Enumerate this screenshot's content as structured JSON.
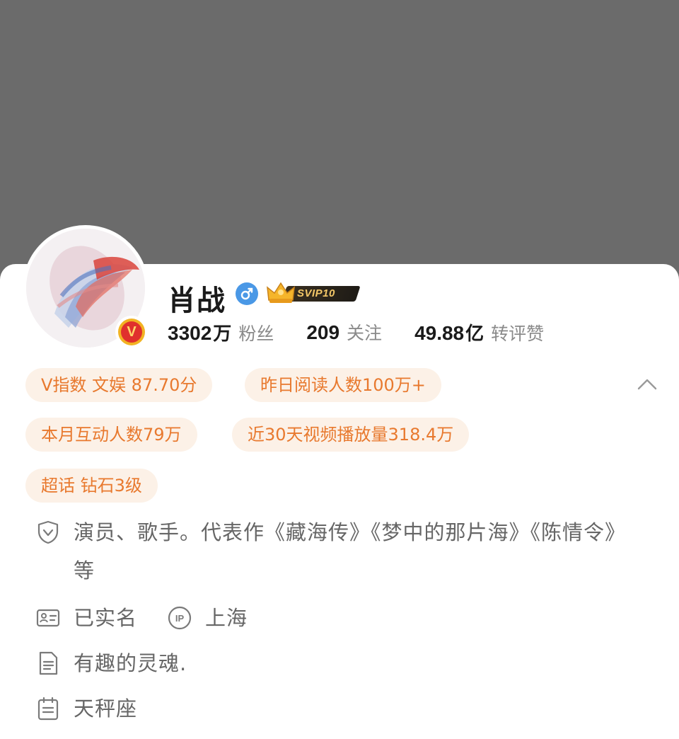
{
  "profile": {
    "name": "肖战",
    "svip_label": "SVIP10",
    "stats": {
      "fans_num": "3302",
      "fans_unit": "万",
      "fans_label": "粉丝",
      "following_num": "209",
      "following_label": "关注",
      "likes_num": "49.88",
      "likes_unit": "亿",
      "likes_label": "转评赞"
    }
  },
  "tags": [
    "V指数 文娱 87.70分",
    "昨日阅读人数100万+",
    "本月互动人数79万",
    "近30天视频播放量318.4万",
    "超话 钻石3级"
  ],
  "info": {
    "verified_desc": "演员、歌手。代表作《藏海传》《梦中的那片海》《陈情令》等",
    "realname": "已实名",
    "ip_location": "上海",
    "bio": "有趣的灵魂.",
    "constellation": "天秤座"
  },
  "icons": {
    "gender": "male-icon",
    "collapse": "chevron-up-icon",
    "verified": "shield-check-icon",
    "realname": "id-card-icon",
    "ip": "ip-icon",
    "bio": "document-icon",
    "constellation": "calendar-icon"
  },
  "colors": {
    "tag_bg": "#fcf1e7",
    "tag_text": "#e8792e",
    "gender_blue": "#4a98e6",
    "cover_gray": "#6b6b6b"
  }
}
